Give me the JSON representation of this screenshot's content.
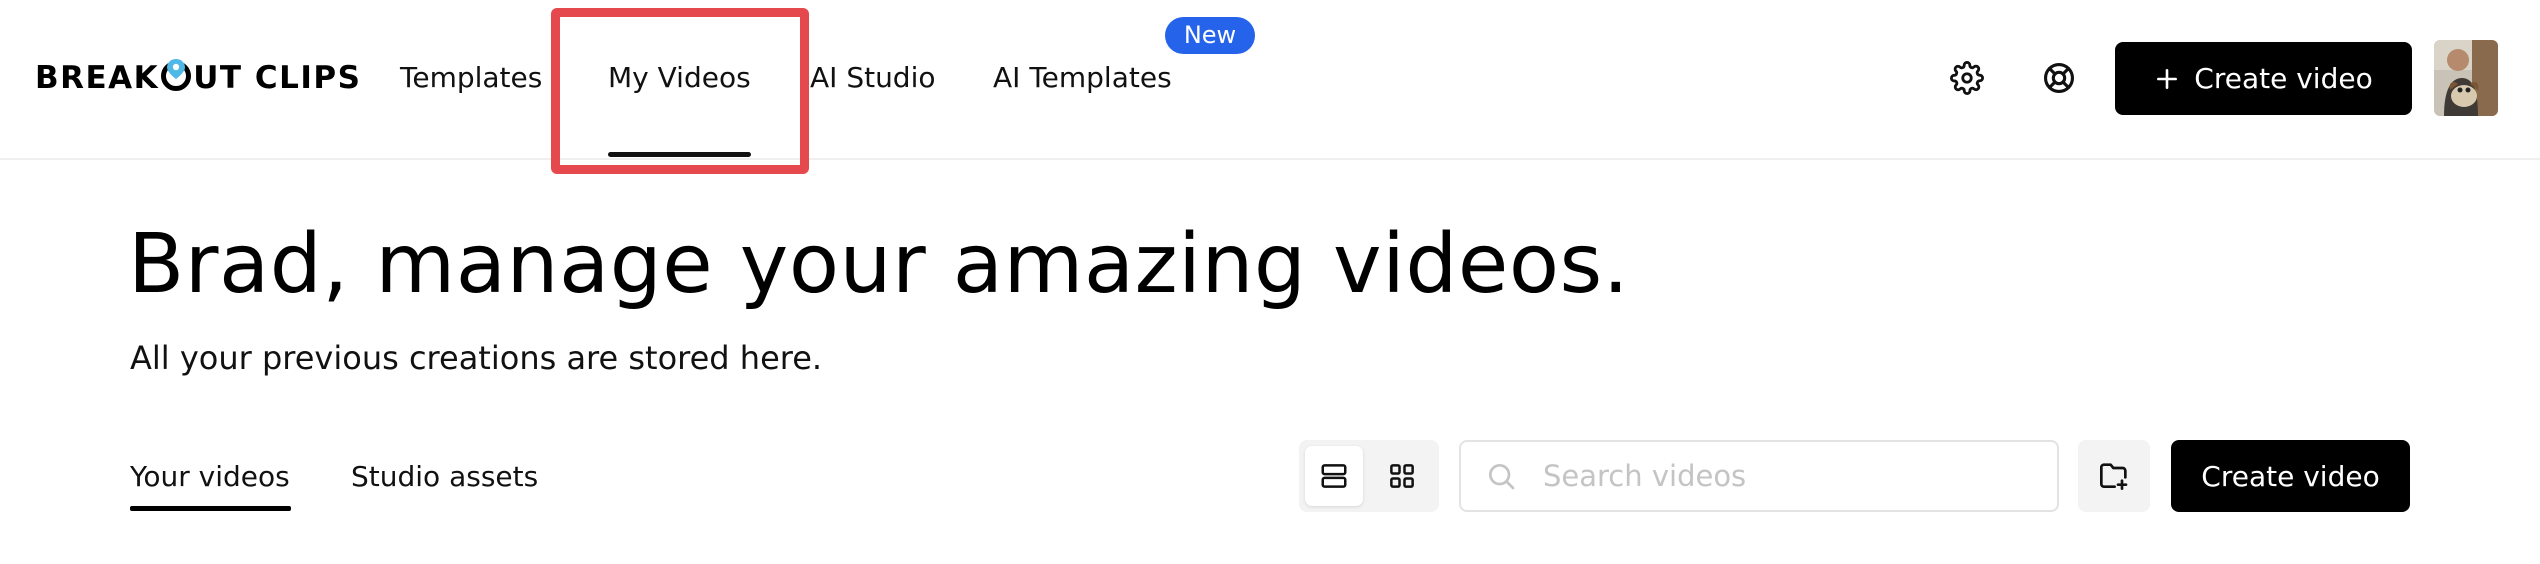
{
  "brand": {
    "logo_left": "BREAK",
    "logo_right": "UT CLIPS",
    "accent_color": "#4fb8e6"
  },
  "nav": {
    "items": [
      {
        "label": "Templates"
      },
      {
        "label": "My Videos",
        "active": true,
        "highlighted": true
      },
      {
        "label": "AI Studio"
      },
      {
        "label": "AI Templates",
        "badge": "New"
      }
    ],
    "badge_color": "#2563eb",
    "highlight_color": "#e5484d"
  },
  "header_actions": {
    "settings_icon": "gear-icon",
    "help_icon": "lifebuoy-icon",
    "create_label": "Create video",
    "create_icon": "plus-icon",
    "avatar": "user-avatar"
  },
  "hero": {
    "title": "Brad, manage your amazing videos.",
    "subtitle": "All your previous creations are stored here."
  },
  "tabs": [
    {
      "label": "Your videos",
      "active": true
    },
    {
      "label": "Studio assets"
    }
  ],
  "toolbar": {
    "view_modes": [
      "list-view-icon",
      "grid-view-icon"
    ],
    "active_view": "list",
    "search": {
      "placeholder": "Search videos",
      "value": ""
    },
    "new_folder_icon": "folder-plus-icon",
    "create_label": "Create video"
  }
}
